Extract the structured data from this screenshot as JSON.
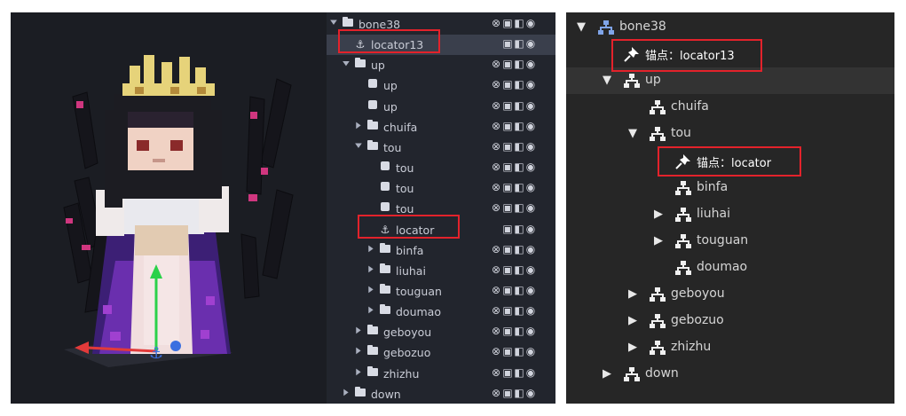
{
  "outliner": {
    "rows": [
      {
        "label": "bone38",
        "indent": 0,
        "type": "folder",
        "chev": "down"
      },
      {
        "label": "locator13",
        "indent": 1,
        "type": "locator",
        "chev": "",
        "selected": true
      },
      {
        "label": "up",
        "indent": 1,
        "type": "folder",
        "chev": "down"
      },
      {
        "label": "up",
        "indent": 2,
        "type": "cube",
        "chev": ""
      },
      {
        "label": "up",
        "indent": 2,
        "type": "cube",
        "chev": ""
      },
      {
        "label": "chuifa",
        "indent": 2,
        "type": "folder",
        "chev": "right"
      },
      {
        "label": "tou",
        "indent": 2,
        "type": "folder",
        "chev": "down"
      },
      {
        "label": "tou",
        "indent": 3,
        "type": "cube",
        "chev": ""
      },
      {
        "label": "tou",
        "indent": 3,
        "type": "cube",
        "chev": ""
      },
      {
        "label": "tou",
        "indent": 3,
        "type": "cube",
        "chev": ""
      },
      {
        "label": "locator",
        "indent": 3,
        "type": "locator",
        "chev": ""
      },
      {
        "label": "binfa",
        "indent": 3,
        "type": "folder",
        "chev": "right"
      },
      {
        "label": "liuhai",
        "indent": 3,
        "type": "folder",
        "chev": "right"
      },
      {
        "label": "touguan",
        "indent": 3,
        "type": "folder",
        "chev": "right"
      },
      {
        "label": "doumao",
        "indent": 3,
        "type": "folder",
        "chev": "right"
      },
      {
        "label": "geboyou",
        "indent": 2,
        "type": "folder",
        "chev": "right"
      },
      {
        "label": "gebozuo",
        "indent": 2,
        "type": "folder",
        "chev": "right"
      },
      {
        "label": "zhizhu",
        "indent": 2,
        "type": "folder",
        "chev": "right"
      },
      {
        "label": "down",
        "indent": 1,
        "type": "folder",
        "chev": "right"
      }
    ]
  },
  "tree": {
    "rows": [
      {
        "label": "bone38",
        "indent": 0,
        "type": "bone",
        "chev": "down"
      },
      {
        "label": "锚点：locator13",
        "indent": 1,
        "type": "pin",
        "chev": ""
      },
      {
        "label": "up",
        "indent": 1,
        "type": "bone",
        "chev": "down",
        "selected": true
      },
      {
        "label": "chuifa",
        "indent": 2,
        "type": "bone",
        "chev": ""
      },
      {
        "label": "tou",
        "indent": 2,
        "type": "bone",
        "chev": "down"
      },
      {
        "label": "锚点：locator",
        "indent": 3,
        "type": "pin",
        "chev": ""
      },
      {
        "label": "binfa",
        "indent": 3,
        "type": "bone",
        "chev": ""
      },
      {
        "label": "liuhai",
        "indent": 3,
        "type": "bone",
        "chev": "right"
      },
      {
        "label": "touguan",
        "indent": 3,
        "type": "bone",
        "chev": "right"
      },
      {
        "label": "doumao",
        "indent": 3,
        "type": "bone",
        "chev": ""
      },
      {
        "label": "geboyou",
        "indent": 2,
        "type": "bone",
        "chev": "right"
      },
      {
        "label": "gebozuo",
        "indent": 2,
        "type": "bone",
        "chev": "right"
      },
      {
        "label": "zhizhu",
        "indent": 2,
        "type": "bone",
        "chev": "right"
      },
      {
        "label": "down",
        "indent": 1,
        "type": "bone",
        "chev": "right"
      }
    ]
  },
  "colors": {
    "highlight": "#e3222b",
    "accent_green": "#2bd14a",
    "accent_red": "#e23a3a",
    "accent_blue": "#3b6fe0"
  }
}
